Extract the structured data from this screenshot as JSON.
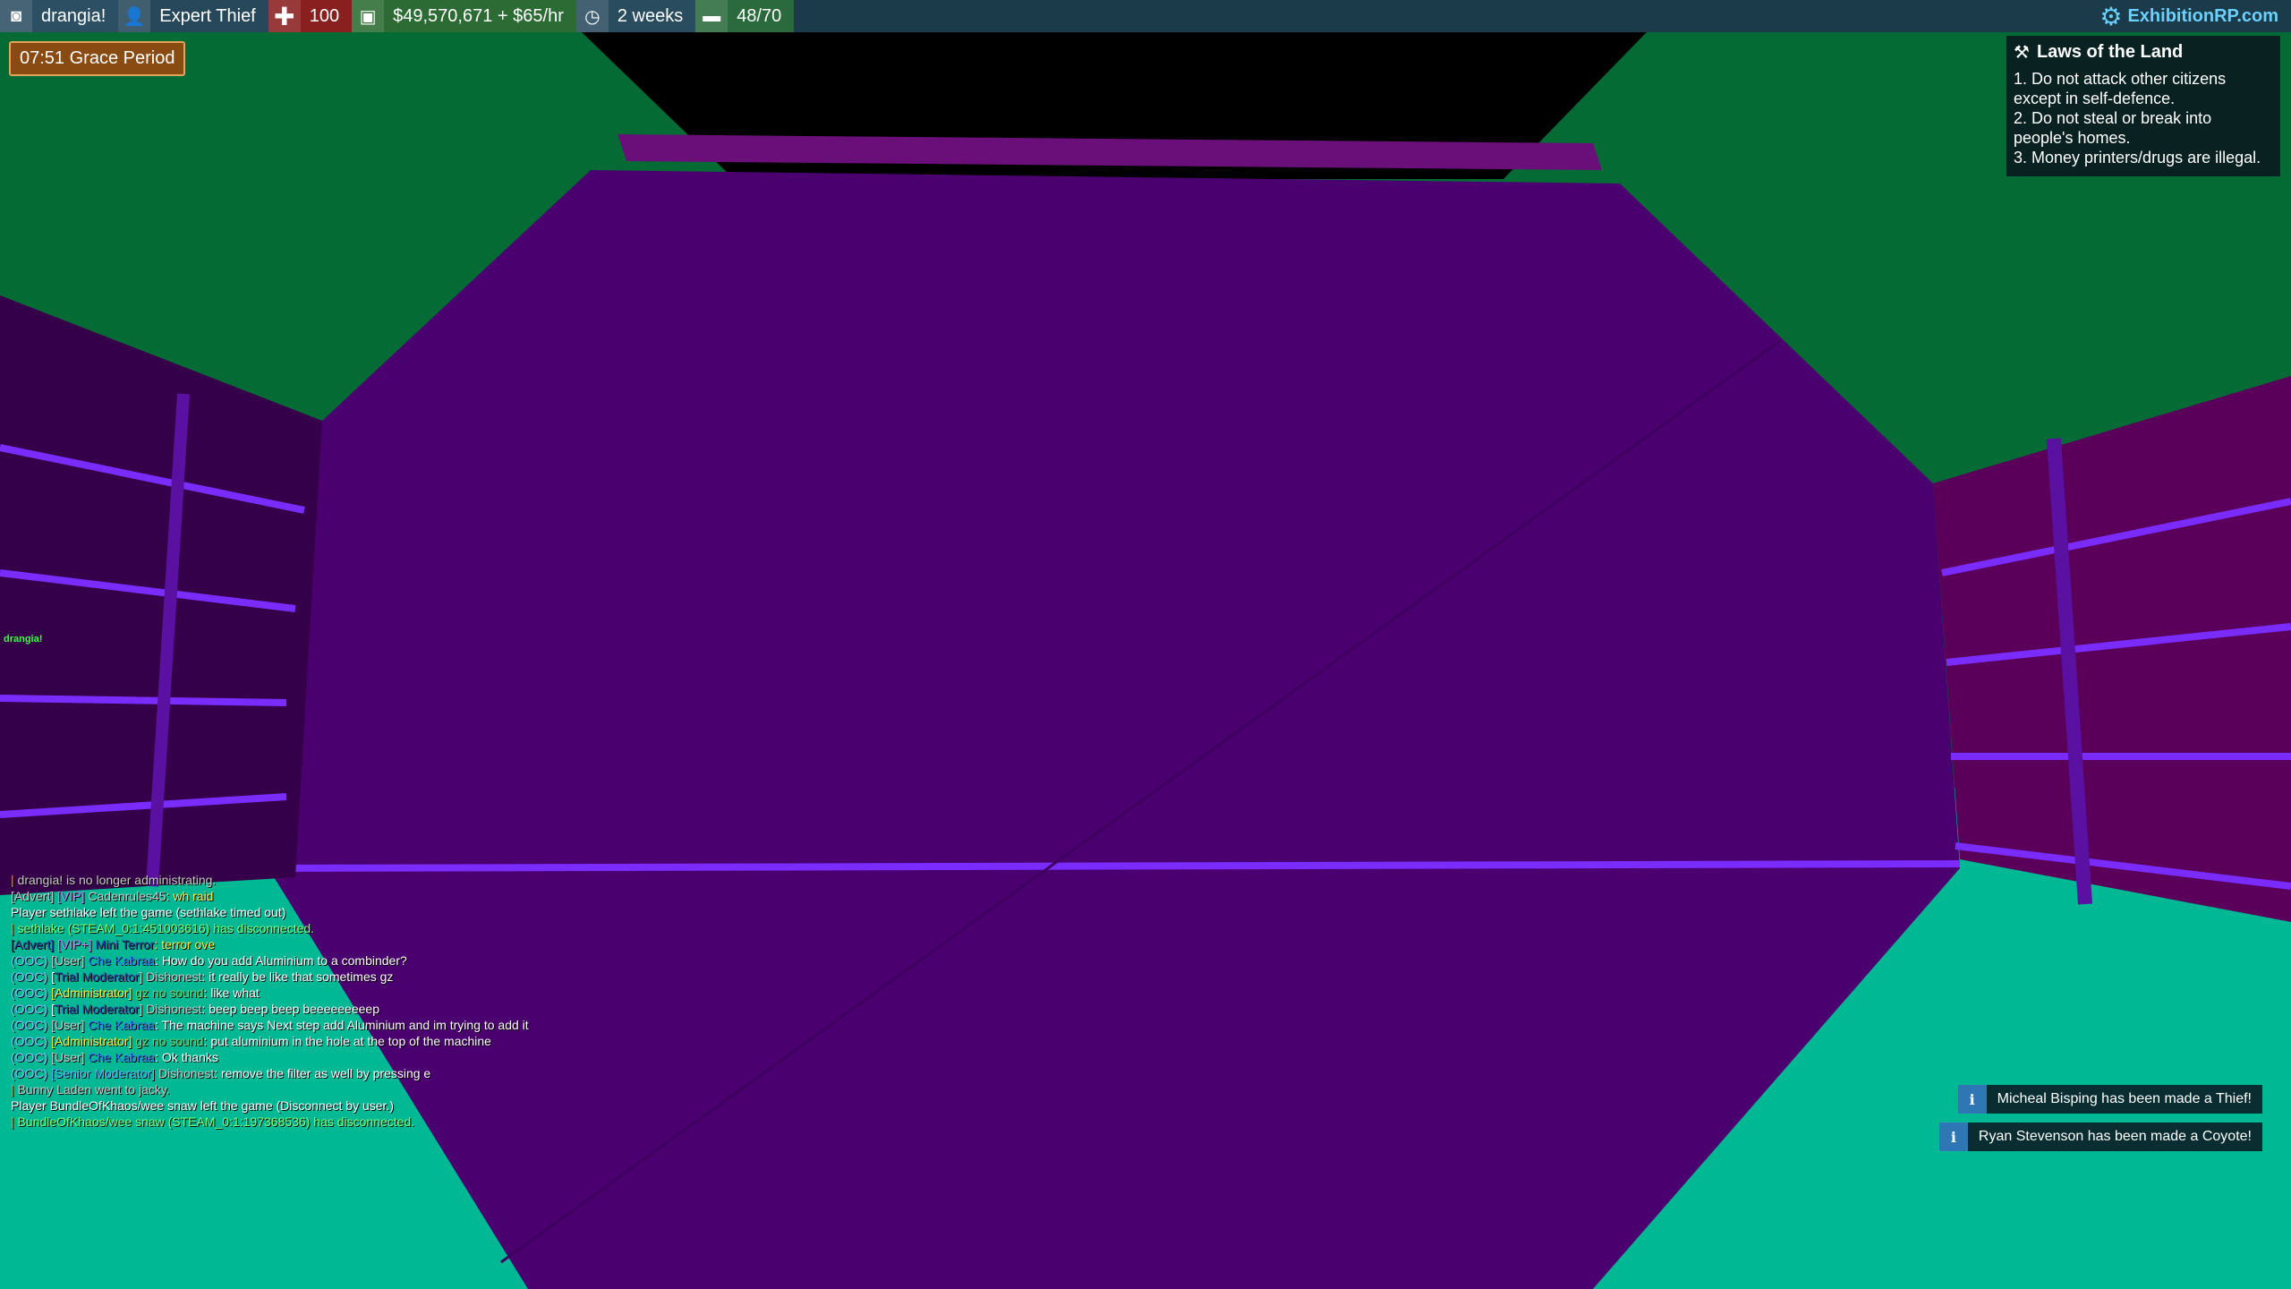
{
  "hud": {
    "player_name": "drangia!",
    "job": "Expert Thief",
    "health": "100",
    "money": "$49,570,671 + $65/hr",
    "playtime": "2 weeks",
    "hunger": "48/70",
    "brand": "ExhibitionRP.com",
    "grace_period": "07:51 Grace Period"
  },
  "laws": {
    "title": "Laws of the Land",
    "items": [
      "1. Do not attack other citizens",
      "except in self-defence.",
      "2. Do not steal or break into",
      "people's homes.",
      "3. Money printers/drugs are illegal."
    ]
  },
  "player_tag": "drangia!",
  "chat": {
    "l0": "drangia! is no longer administrating.",
    "l1a": "[Advert]",
    "l1b": "[VIP]",
    "l1c": "Cadenrules45",
    "l1d": ": wh raid",
    "l2": "Player sethlake left the game (sethlake timed out)",
    "l3": "sethlake (STEAM_0:1:451003616) has disconnected.",
    "l4a": "[Advert]",
    "l4b": "[VIP+]",
    "l4c": "Mini Terror",
    "l4d": ": terror ove",
    "l5a": "(OOC)",
    "l5b": "[User]",
    "l5c": "Che Kabraa",
    "l5d": ": How do you add Aluminium to a combinder?",
    "l6a": "(OOC)",
    "l6b": "[",
    "l6c": "Trial Moderator",
    "l6d": "] Dishonest",
    "l6e": ": it really be like that sometimes gz",
    "l7a": "(OOC)",
    "l7b": "[Administrator]",
    "l7c": "gz no sound",
    "l7d": ": like what",
    "l8a": "(OOC)",
    "l8b": "[",
    "l8c": "Trial Moderator",
    "l8d": "] Dishonest",
    "l8e": ": beep beep beep beeeeeeeeep",
    "l9a": "(OOC)",
    "l9b": "[User]",
    "l9c": "Che Kabraa",
    "l9d": ": The machine says Next step add Aluminium and im trying to add it",
    "l10a": "(OOC)",
    "l10b": "[Administrator]",
    "l10c": "gz no sound",
    "l10d": ": put aluminium in the hole at the top of the machine",
    "l11a": "(OOC)",
    "l11b": "[User]",
    "l11c": "Che Kabraa",
    "l11d": ": Ok thanks",
    "l12a": "(OOC)",
    "l12b": "[Senior Moderator]",
    "l12c": "Dishonest",
    "l12d": ": remove the filter as well by pressing e",
    "l13": "Bunny Laden went to jacky.",
    "l14": "Player BundleOfKhaos/wee snaw left the game (Disconnect by user.)",
    "l15": "BundleOfKhaos/wee snaw (STEAM_0:1:197368536) has disconnected."
  },
  "notices": {
    "n1": "Micheal Bisping has been made a Thief!",
    "n2": "Ryan Stevenson has been made a Coyote!"
  },
  "colors": {
    "floor": "#00b894",
    "wall_green": "#046b34",
    "purple": "#4b0070",
    "accent": "#7a2cff"
  }
}
